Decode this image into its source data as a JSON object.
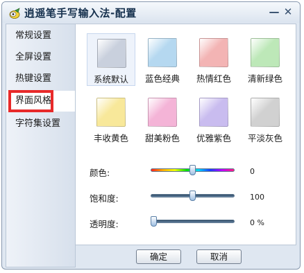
{
  "window": {
    "title": "逍遥笔手写输入法-配置"
  },
  "titlebar_buttons": {
    "minimize": "—",
    "close": "✕"
  },
  "sidebar": {
    "items": [
      {
        "label": "常规设置"
      },
      {
        "label": "全屏设置"
      },
      {
        "label": "热键设置"
      },
      {
        "label": "界面风格",
        "selected": true
      },
      {
        "label": "字符集设置"
      }
    ]
  },
  "themes": [
    {
      "label": "系统默认",
      "color": "#c9d0dd",
      "selected": true
    },
    {
      "label": "蓝色经典",
      "color": "#b5d8f0"
    },
    {
      "label": "热情红色",
      "color": "#f3b4b4"
    },
    {
      "label": "清新绿色",
      "color": "#bde8b8"
    },
    {
      "label": "丰收黄色",
      "color": "#f8e89a"
    },
    {
      "label": "甜美粉色",
      "color": "#f4b4d7"
    },
    {
      "label": "优雅紫色",
      "color": "#c9bcef"
    },
    {
      "label": "平淡灰色",
      "color": "#d1d1d1"
    }
  ],
  "sliders": {
    "color": {
      "label": "颜色:",
      "value": "0",
      "position": 0.5
    },
    "saturation": {
      "label": "饱和度:",
      "value": "100",
      "position": 0.5
    },
    "transparency": {
      "label": "透明度:",
      "value": "0 %",
      "position": 0.0
    }
  },
  "buttons": {
    "ok": "确定",
    "cancel": "取消"
  },
  "colors": {
    "window_bg": "#dfe7f1",
    "border": "#8798ae",
    "selection_frame": "#e82a2a",
    "title_text": "#15304d"
  }
}
